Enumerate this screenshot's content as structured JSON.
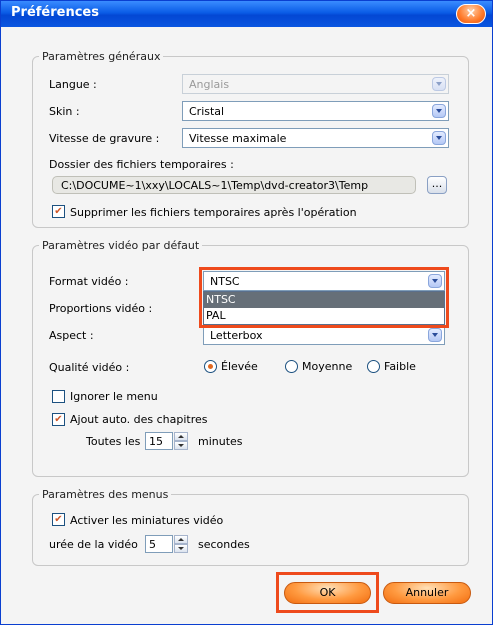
{
  "window": {
    "title": "Préférences",
    "close_glyph": "×"
  },
  "general": {
    "legend": "Paramètres généraux",
    "language_label": "Langue :",
    "language_value": "Anglais",
    "skin_label": "Skin :",
    "skin_value": "Cristal",
    "burn_speed_label": "Vitesse de gravure :",
    "burn_speed_value": "Vitesse maximale",
    "temp_folder_label": "Dossier des fichiers temporaires :",
    "temp_folder_value": "C:\\DOCUME~1\\xxy\\LOCALS~1\\Temp\\dvd-creator3\\Temp",
    "browse_label": "...",
    "delete_temp_label": "Supprimer les fichiers temporaires après l'opération",
    "delete_temp_checked": true
  },
  "video": {
    "legend": "Paramètres vidéo par défaut",
    "format_label": "Format vidéo :",
    "format_value": "NTSC",
    "format_options": [
      "NTSC",
      "PAL"
    ],
    "proportions_label": "Proportions vidéo :",
    "aspect_label": "Aspect :",
    "aspect_value": "Letterbox",
    "quality_label": "Qualité vidéo :",
    "quality_options": [
      "Élevée",
      "Moyenne",
      "Faible"
    ],
    "quality_selected": "Élevée",
    "ignore_menu_label": "Ignorer le menu",
    "ignore_menu_checked": false,
    "auto_chapters_label": "Ajout auto. des chapitres",
    "auto_chapters_checked": true,
    "every_label": "Toutes les",
    "every_value": "15",
    "minutes_label": "minutes"
  },
  "menus": {
    "legend": "Paramètres des menus",
    "thumbnails_label": "Activer les miniatures vidéo",
    "thumbnails_checked": true,
    "duration_label": "urée de la vidéo",
    "duration_value": "5",
    "seconds_label": "secondes"
  },
  "buttons": {
    "ok_label": "OK",
    "cancel_label": "Annuler"
  },
  "colors": {
    "highlight": "#ee4a1c",
    "titlebar": "#0a5ce6",
    "button": "#ff9a40"
  }
}
